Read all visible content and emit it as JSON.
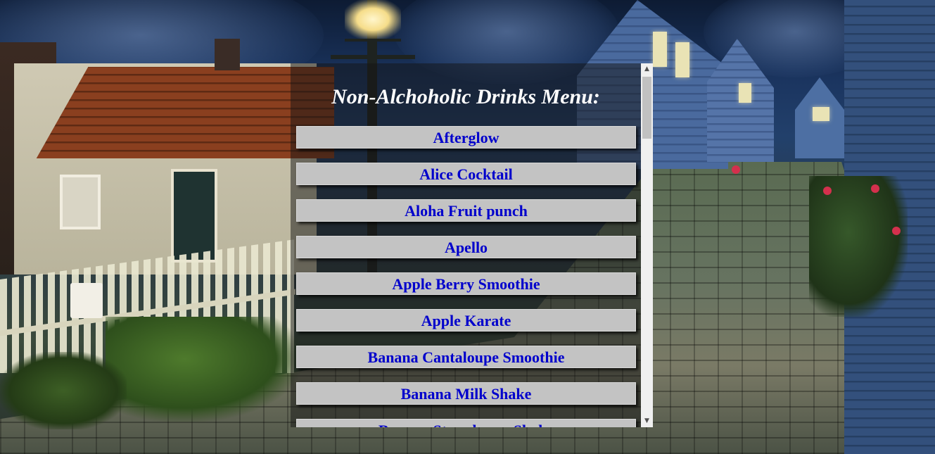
{
  "page": {
    "title": "Non-Alchoholic Drinks Menu:"
  },
  "menu": {
    "items": [
      {
        "label": "Afterglow"
      },
      {
        "label": "Alice Cocktail"
      },
      {
        "label": "Aloha Fruit punch"
      },
      {
        "label": "Apello"
      },
      {
        "label": "Apple Berry Smoothie"
      },
      {
        "label": "Apple Karate"
      },
      {
        "label": "Banana Cantaloupe Smoothie"
      },
      {
        "label": "Banana Milk Shake"
      },
      {
        "label": "Banana Strawberry Shake"
      }
    ]
  },
  "colors": {
    "item_background": "#c3c3c3",
    "item_text": "#0000cc",
    "title_text": "#ffffff",
    "overlay": "rgba(20,20,20,0.5)"
  },
  "scrollbar": {
    "up_icon": "triangle-up-icon",
    "down_icon": "triangle-down-icon"
  },
  "background": {
    "description_icon": "night-village-street-photo"
  }
}
